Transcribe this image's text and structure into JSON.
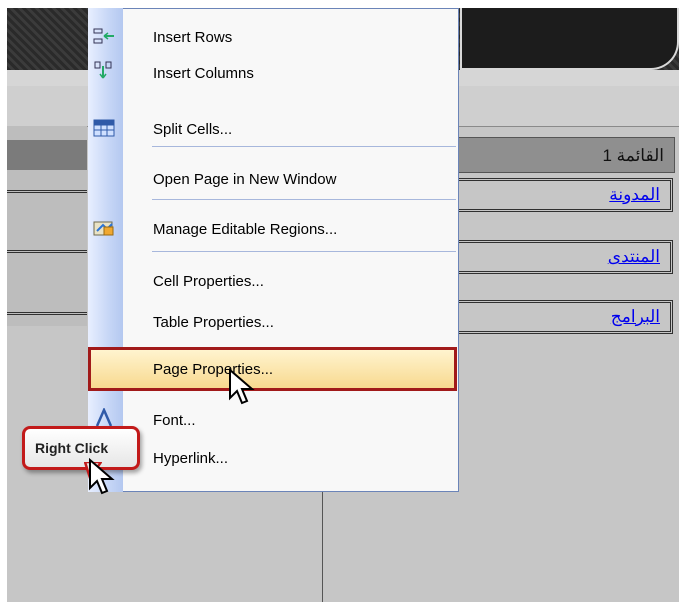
{
  "context_menu": {
    "items": [
      {
        "label": "Insert Rows",
        "icon": "insert-rows-icon"
      },
      {
        "label": "Insert Columns",
        "icon": "insert-columns-icon"
      },
      {
        "label": "Split Cells...",
        "icon": "split-cells-icon"
      },
      {
        "label": "Open Page in New Window",
        "icon": ""
      },
      {
        "label": "Manage Editable Regions...",
        "icon": "editable-regions-icon"
      },
      {
        "label": "Cell Properties...",
        "icon": ""
      },
      {
        "label": "Table Properties...",
        "icon": ""
      },
      {
        "label": "Page Properties...",
        "icon": ""
      },
      {
        "label": "Font...",
        "icon": "font-icon"
      },
      {
        "label": "Hyperlink...",
        "icon": "hyperlink-icon"
      }
    ],
    "highlighted_item": "Page Properties...",
    "highlight_color": "#a11a1a"
  },
  "page_menu": {
    "heading": "القائمة 1",
    "links": [
      "المدونة",
      "المنتدى",
      "البرامج"
    ]
  },
  "callout": {
    "text": "Right Click",
    "border_color": "#c21a1a"
  },
  "colors": {
    "background": "#c6c6c6",
    "link": "#0000ee",
    "menu_border": "#6b84b8"
  }
}
